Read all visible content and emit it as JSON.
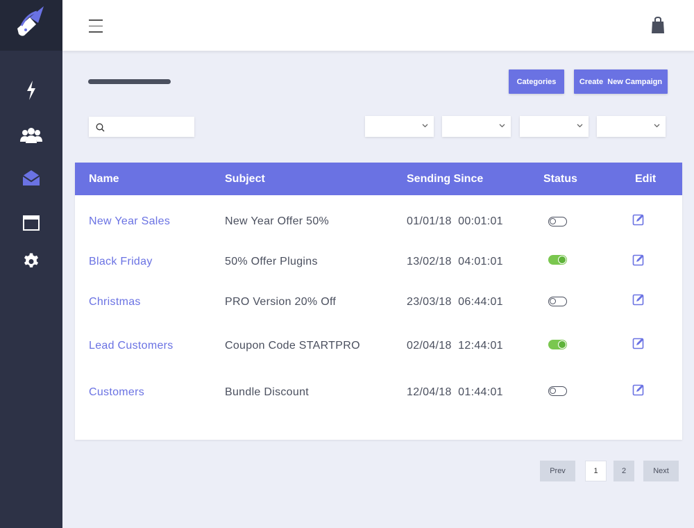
{
  "sidebar": {
    "items": [
      {
        "icon": "lightning-icon"
      },
      {
        "icon": "users-icon"
      },
      {
        "icon": "mail-icon"
      },
      {
        "icon": "calendar-icon"
      },
      {
        "icon": "gear-icon"
      }
    ],
    "active_color": "#6a72e3"
  },
  "toolbar": {
    "categories_label": "Categories",
    "create_label": "Create  New Campaign"
  },
  "search": {
    "placeholder": ""
  },
  "table": {
    "headers": [
      "Name",
      "Subject",
      "Sending Since",
      "Status",
      "Edit"
    ],
    "rows": [
      {
        "name": "New Year Sales",
        "subject": "New Year Offer 50%",
        "since": "01/01/18  00:01:01",
        "status": "off"
      },
      {
        "name": "Black Friday",
        "subject": "50% Offer Plugins",
        "since": "13/02/18  04:01:01",
        "status": "on"
      },
      {
        "name": "Christmas",
        "subject": "PRO Version 20% Off",
        "since": "23/03/18  06:44:01",
        "status": "off"
      },
      {
        "name": "Lead Customers",
        "subject": "Coupon Code STARTPRO",
        "since": "02/04/18  12:44:01",
        "status": "on"
      },
      {
        "name": "Customers",
        "subject": "Bundle Discount",
        "since": "12/04/18  01:44:01",
        "status": "off"
      }
    ]
  },
  "pagination": {
    "prev": "Prev",
    "pages": [
      "1",
      "2"
    ],
    "next": "Next"
  },
  "colors": {
    "accent": "#6a72e3",
    "sidebar": "#2d3246",
    "toggle_on": "#7ac74f"
  }
}
